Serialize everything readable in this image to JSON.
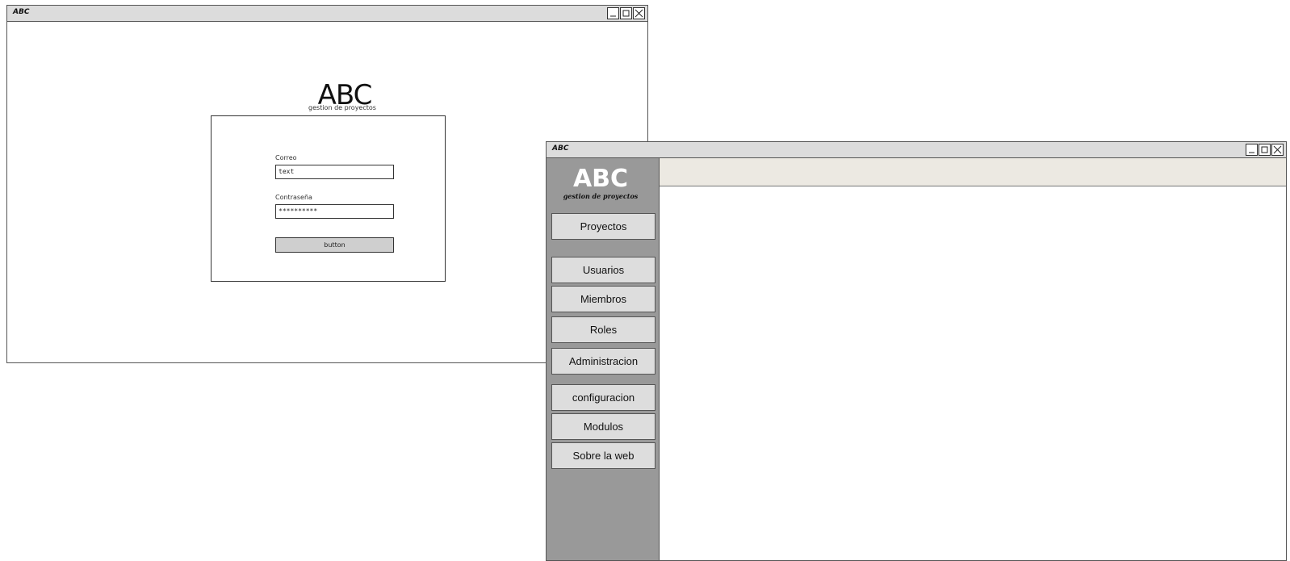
{
  "login_window": {
    "title": "ABC",
    "logo": "ABC",
    "subtitle": "gestion de proyectos",
    "email_label": "Correo",
    "email_value": "text",
    "password_label": "Contraseña",
    "password_value": "**********",
    "button_label": "button"
  },
  "app_window": {
    "title": "ABC",
    "logo": "ABC",
    "subtitle": "gestion de proyectos",
    "nav": [
      {
        "label": "Proyectos"
      },
      {
        "label": "Usuarios"
      },
      {
        "label": "Miembros"
      },
      {
        "label": "Roles"
      },
      {
        "label": "Administracion"
      },
      {
        "label": "configuracion"
      },
      {
        "label": "Modulos"
      },
      {
        "label": "Sobre la web"
      }
    ]
  },
  "icons": {
    "minimize": "minimize-icon",
    "maximize": "maximize-icon",
    "close": "close-icon"
  },
  "colors": {
    "titlebar": "#dcdcdc",
    "sidebar": "#999999",
    "nav_button": "#dddddd",
    "top_band": "#ece9e2"
  }
}
